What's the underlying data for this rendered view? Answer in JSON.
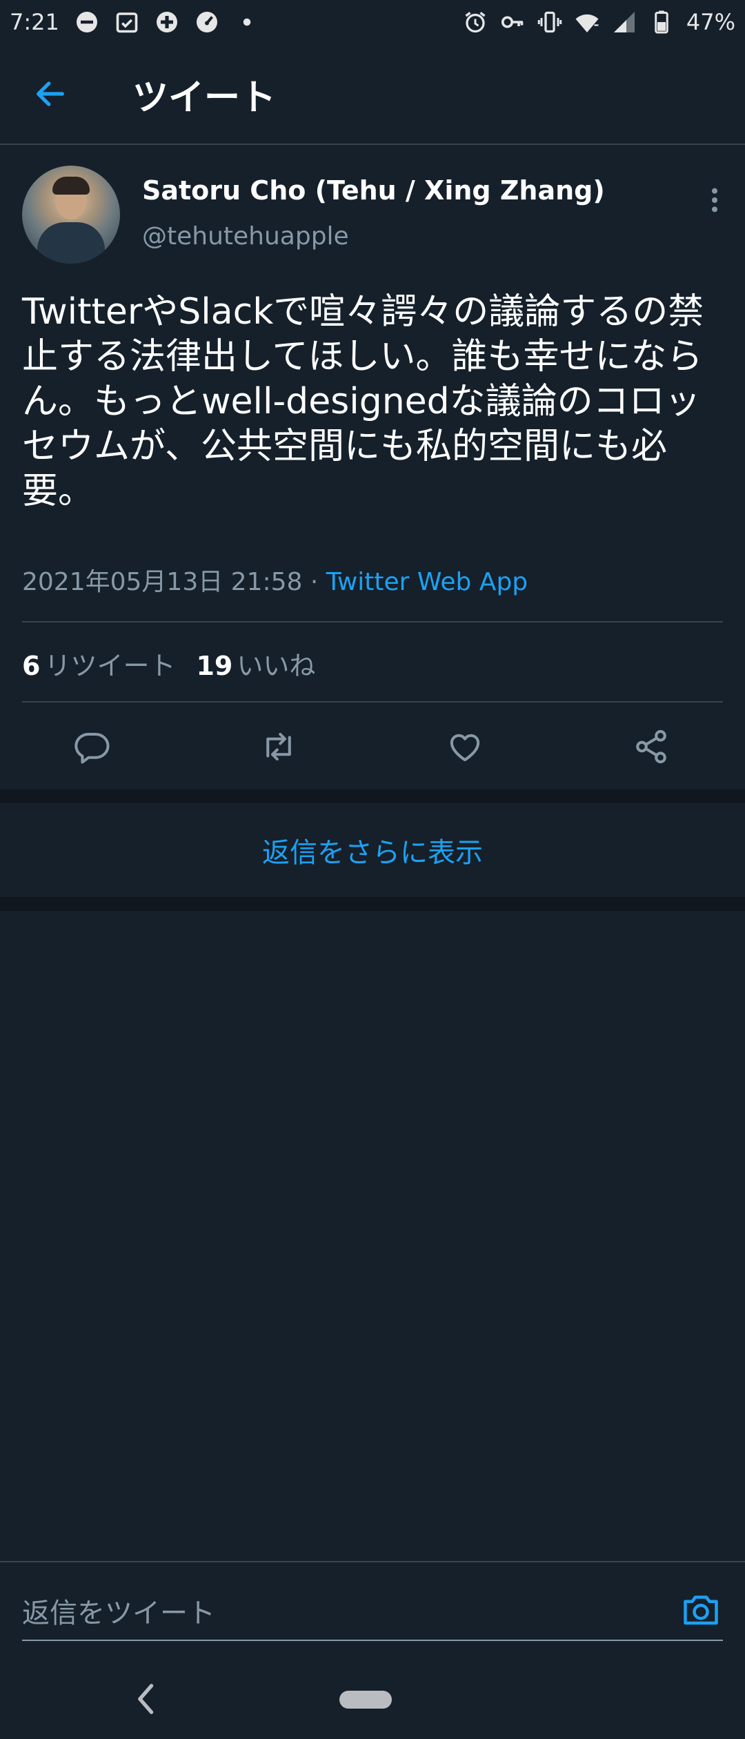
{
  "status_bar": {
    "time": "7:21",
    "battery": "47%",
    "left_icons": [
      "do-not-disturb-icon",
      "calendar-check-icon",
      "medical-plus-icon",
      "speedometer-icon",
      "dot-icon"
    ],
    "right_icons": [
      "alarm-icon",
      "key-icon",
      "vibrate-icon",
      "wifi-icon",
      "signal-icon",
      "battery-icon"
    ]
  },
  "header": {
    "title": "ツイート",
    "back_icon": "arrow-left-icon"
  },
  "tweet": {
    "author_name": "Satoru Cho (Tehu / Xing Zhang)",
    "author_handle": "@tehutehuapple",
    "text": "TwitterやSlackで喧々諤々の議論するの禁止する法律出してほしい。誰も幸せにならん。もっとwell-designedな議論のコロッセウムが、公共空間にも私的空間にも必要。",
    "timestamp": "2021年05月13日 21:58",
    "separator": " · ",
    "source": "Twitter Web App",
    "retweet_count": "6",
    "retweet_label": "リツイート",
    "like_count": "19",
    "like_label": "いいね"
  },
  "actions": [
    "reply-icon",
    "retweet-icon",
    "like-icon",
    "share-icon"
  ],
  "more_replies_label": "返信をさらに表示",
  "composer": {
    "placeholder": "返信をツイート"
  },
  "colors": {
    "background": "#15202b",
    "accent": "#1da1f2",
    "secondary_text": "#8899a6",
    "divider": "#38444d"
  }
}
